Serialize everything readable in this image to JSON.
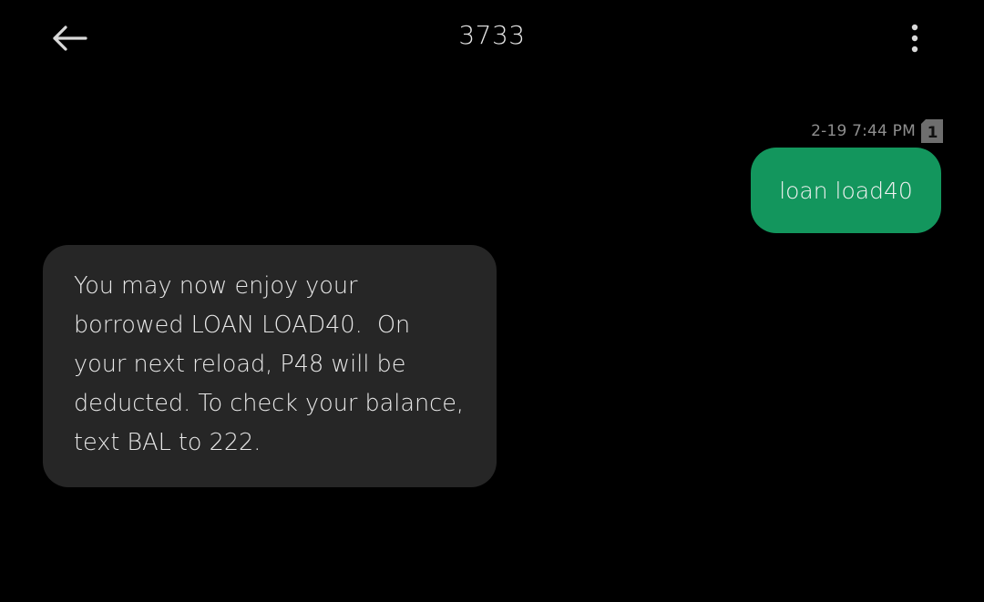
{
  "header": {
    "title": "3733",
    "back_icon": "arrow-left-icon",
    "menu_icon": "more-vertical-icon"
  },
  "messages": [
    {
      "direction": "outgoing",
      "timestamp": "2-19 7:44 PM",
      "sim_slot": "1",
      "text": "loan load40",
      "bubble_color": "#13965d"
    },
    {
      "direction": "incoming",
      "text": "You may now enjoy your borrowed LOAN LOAD40.  On your next reload, P48 will be deducted. To check your balance, text BAL to 222.",
      "bubble_color": "#262626"
    }
  ],
  "theme": {
    "background": "#000000",
    "text": "#e8e8e8",
    "muted": "#8e8e8e"
  }
}
